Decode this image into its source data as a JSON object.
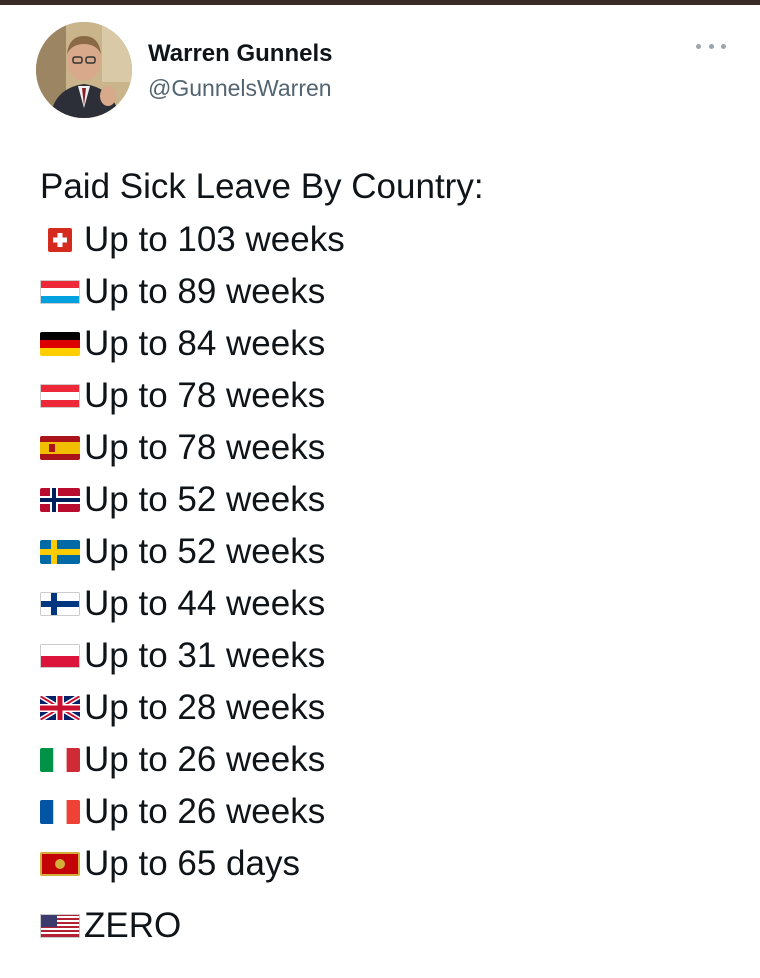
{
  "tweet": {
    "author": {
      "name": "Warren Gunnels",
      "handle": "@GunnelsWarren"
    },
    "intro": "Paid Sick Leave By Country:",
    "lines": [
      {
        "flag": "switzerland-flag-icon",
        "text": "Up to 103 weeks"
      },
      {
        "flag": "luxembourg-flag-icon",
        "text": "Up to 89 weeks"
      },
      {
        "flag": "germany-flag-icon",
        "text": "Up to 84 weeks"
      },
      {
        "flag": "austria-flag-icon",
        "text": "Up to 78 weeks"
      },
      {
        "flag": "spain-flag-icon",
        "text": "Up to 78 weeks"
      },
      {
        "flag": "norway-flag-icon",
        "text": "Up to 52 weeks"
      },
      {
        "flag": "sweden-flag-icon",
        "text": "Up to 52 weeks"
      },
      {
        "flag": "finland-flag-icon",
        "text": "Up to 44 weeks"
      },
      {
        "flag": "poland-flag-icon",
        "text": "Up to 31 weeks"
      },
      {
        "flag": "uk-flag-icon",
        "text": "Up to 28 weeks"
      },
      {
        "flag": "italy-flag-icon",
        "text": "Up to 26 weeks"
      },
      {
        "flag": "france-flag-icon",
        "text": "Up to 26 weeks"
      },
      {
        "flag": "montenegro-flag-icon",
        "text": "Up to 65 days"
      }
    ],
    "closing": {
      "flag": "usa-flag-icon",
      "text": "ZERO"
    }
  },
  "icons": {
    "avatar": "avatar-photo",
    "more": "more-options-icon"
  }
}
